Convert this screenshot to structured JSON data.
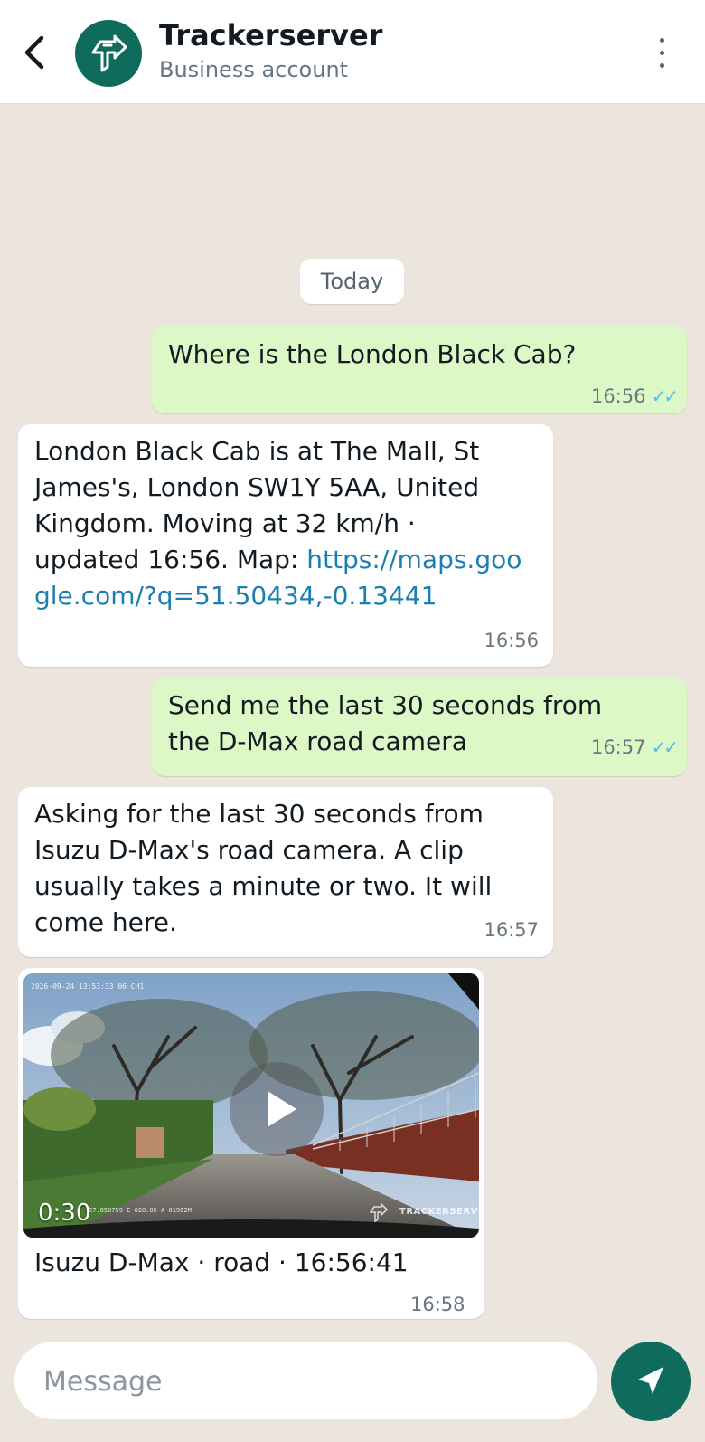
{
  "header": {
    "title": "Trackerserver",
    "subtitle": "Business account",
    "back_icon": "chevron-left-icon",
    "menu_icon": "more-vertical-icon"
  },
  "chat": {
    "date_separator": "Today",
    "messages": [
      {
        "direction": "outgoing",
        "text": "Where is the London Black Cab?",
        "time": "16:56",
        "status": "read"
      },
      {
        "direction": "incoming",
        "text": "London Black Cab is at The Mall, St James's, London SW1Y 5AA, United Kingdom. Moving at 32 km/h · updated 16:56. Map:",
        "link": "https://maps.google.com/?q=51.50434,-0.13441",
        "time": "16:56"
      },
      {
        "direction": "outgoing",
        "text": "Send me the last 30 seconds from the D-Max road camera",
        "time": "16:57",
        "status": "read"
      },
      {
        "direction": "incoming",
        "text": "Asking for the last 30 seconds from Isuzu D-Max's road camera. A clip usually takes a minute or two. It will come here.",
        "time": "16:57"
      },
      {
        "direction": "incoming",
        "type": "video",
        "duration": "0:30",
        "caption": "Isuzu D-Max · road · 16:56:41",
        "time": "16:58",
        "overlay_timestamp": "2026-09-24 13:53:33 06 CH1",
        "overlay_coords": "27.850759 E 028.05-A 01962M",
        "watermark": "TRACKERSERVER"
      }
    ]
  },
  "composer": {
    "placeholder": "Message",
    "send_icon": "send-icon"
  },
  "colors": {
    "brand": "#0f6b5c",
    "outgoing_bubble": "#dcf8c6",
    "incoming_bubble": "#ffffff",
    "chat_background": "#ece5dd",
    "read_ticks": "#53bdeb",
    "link": "#1d7fb0"
  }
}
